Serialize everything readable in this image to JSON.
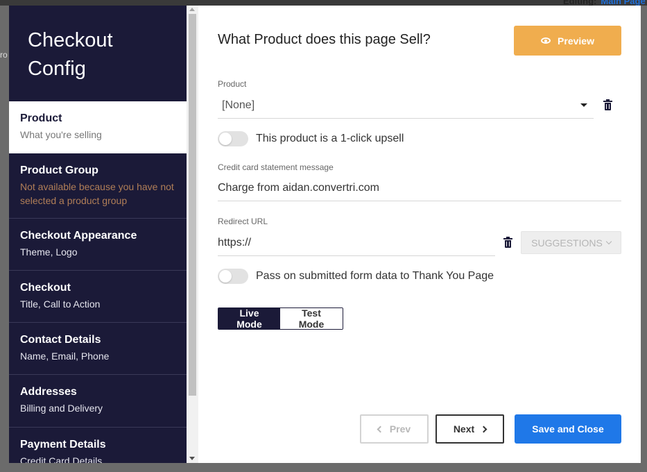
{
  "background": {
    "editing_label": "Editing:",
    "editing_link": "Main Page",
    "left_text": "ro"
  },
  "sidebar": {
    "title": "Checkout Config",
    "items": [
      {
        "title": "Product",
        "subtitle": "What you're selling",
        "active": true
      },
      {
        "title": "Product Group",
        "subtitle": "Not available because you have not selected a product group",
        "warn": true
      },
      {
        "title": "Checkout Appearance",
        "subtitle": "Theme, Logo"
      },
      {
        "title": "Checkout",
        "subtitle": "Title, Call to Action"
      },
      {
        "title": "Contact Details",
        "subtitle": "Name, Email, Phone"
      },
      {
        "title": "Addresses",
        "subtitle": "Billing and Delivery"
      },
      {
        "title": "Payment Details",
        "subtitle": "Credit Card Details"
      }
    ]
  },
  "main": {
    "heading": "What Product does this page Sell?",
    "preview_label": "Preview",
    "product": {
      "label": "Product",
      "value": "[None]"
    },
    "upsell_toggle": {
      "label": "This product is a 1-click upsell",
      "on": false
    },
    "statement": {
      "label": "Credit card statement message",
      "value": "Charge from aidan.convertri.com"
    },
    "redirect": {
      "label": "Redirect URL",
      "value": "https://",
      "suggestions_label": "SUGGESTIONS"
    },
    "pass_toggle": {
      "label": "Pass on submitted form data to Thank You Page",
      "on": false
    },
    "modes": {
      "live": "Live Mode",
      "test": "Test Mode",
      "selected": "Live Mode"
    },
    "footer": {
      "prev": "Prev",
      "next": "Next",
      "save": "Save and Close"
    }
  },
  "colors": {
    "sidebar_bg": "#1b1a38",
    "preview": "#f0ad4e",
    "primary": "#1f78e8",
    "warn_text": "#b07e57"
  }
}
